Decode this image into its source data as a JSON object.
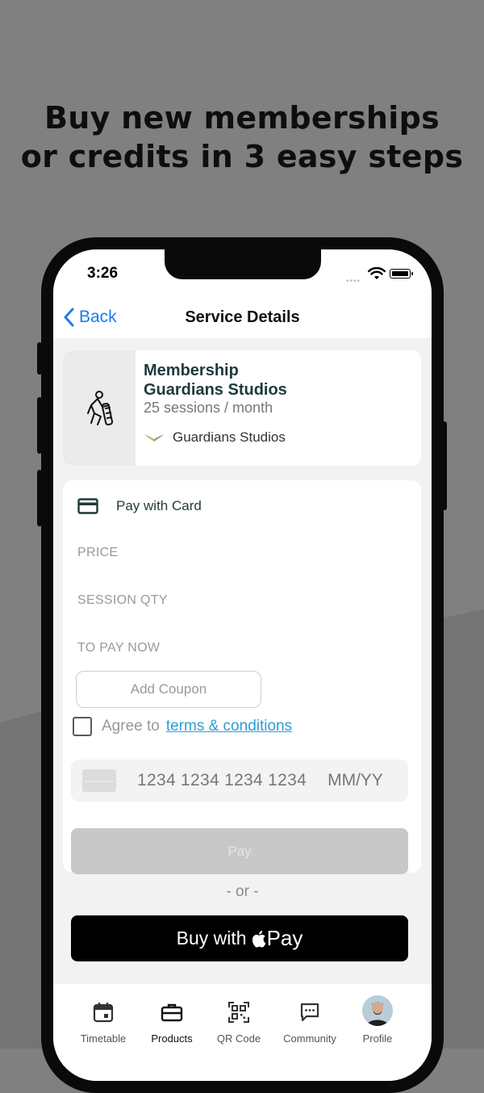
{
  "headline": [
    "Buy new memberships",
    "or credits in 3 easy steps"
  ],
  "status_bar": {
    "time": "3:26"
  },
  "nav": {
    "back_label": "Back",
    "title": "Service Details"
  },
  "service": {
    "name": "Membership\nGuardians Studios",
    "name_line1": "Membership",
    "name_line2": "Guardians Studios",
    "subtitle": "25 sessions / month",
    "studio": "Guardians Studios"
  },
  "payment": {
    "method_label": "Pay with Card",
    "price_label": "PRICE",
    "qty_label": "SESSION QTY",
    "to_pay_label": "TO PAY NOW",
    "coupon_placeholder": "Add Coupon",
    "agree_text": "Agree to",
    "terms_link": "terms & conditions",
    "card_number_placeholder": "1234 1234 1234 1234",
    "card_exp_placeholder": "MM/YY",
    "pay_button": "Pay"
  },
  "or_separator": "- or -",
  "apple_pay": {
    "prefix": "Buy with",
    "pay_word": "Pay"
  },
  "tabs": [
    {
      "label": "Timetable",
      "icon": "calendar-icon"
    },
    {
      "label": "Products",
      "icon": "briefcase-icon",
      "active": true
    },
    {
      "label": "QR Code",
      "icon": "qr-code-icon"
    },
    {
      "label": "Community",
      "icon": "chat-icon"
    },
    {
      "label": "Profile",
      "icon": "avatar"
    }
  ],
  "colors": {
    "background": "#808080",
    "link_blue": "#1a7cf0",
    "terms_blue": "#2a9fd6",
    "apple_button": "#000000",
    "pay_button_disabled": "#c8c8c8"
  }
}
